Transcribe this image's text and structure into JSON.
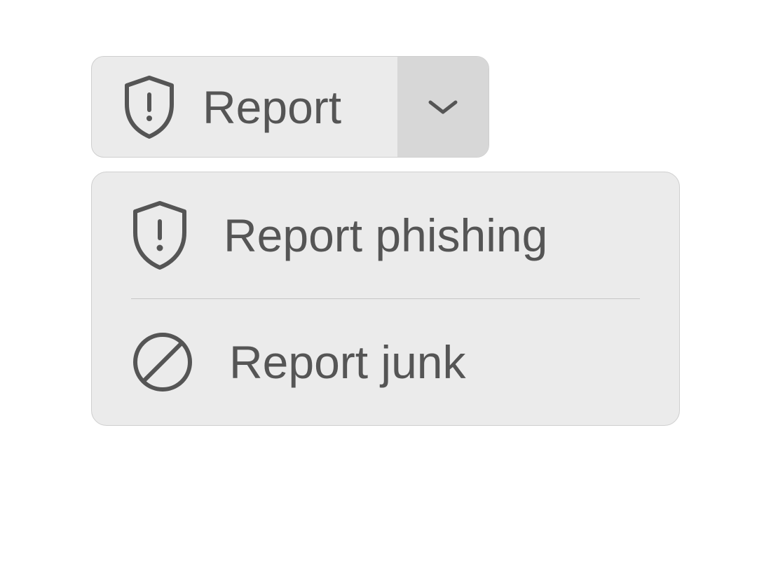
{
  "button": {
    "label": "Report",
    "icon": "shield-alert-icon"
  },
  "menu": {
    "items": [
      {
        "label": "Report phishing",
        "icon": "shield-alert-icon"
      },
      {
        "label": "Report junk",
        "icon": "block-icon"
      }
    ]
  }
}
